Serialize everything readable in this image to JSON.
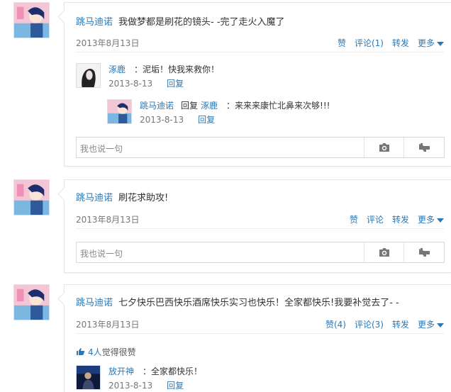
{
  "posts": [
    {
      "user": "跳马迪诺",
      "text": "我做梦都是刷花的镜头- -完了走火入魔了",
      "date": "2013年8月13日",
      "actions": {
        "like": "赞",
        "comment": "评论(1)",
        "share": "转发",
        "more": "更多"
      },
      "comments": [
        {
          "user": "涿鹿",
          "text": "：泥垢！快我来救你！",
          "date": "2013-8-13",
          "reply_label": "回复"
        }
      ],
      "subreply": {
        "user": "跳马迪诺",
        "reply_word": "回复",
        "reply_to": "涿鹿",
        "text": "：来来来康忙北鼻来次够!!!",
        "date": "2013-8-13",
        "reply_label": "回复"
      },
      "input_placeholder": "我也说一句"
    },
    {
      "user": "跳马迪诺",
      "text": "刷花求助攻!",
      "date": "2013年8月13日",
      "actions": {
        "like": "赞",
        "comment": "评论",
        "share": "转发",
        "more": "更多"
      },
      "input_placeholder": "我也说一句"
    },
    {
      "user": "跳马迪诺",
      "text": "七夕快乐巴西快乐酒席快乐实习也快乐！全家都快乐!我要补觉去了- -",
      "date": "2013年8月13日",
      "actions": {
        "like": "赞(4)",
        "comment": "评论(3)",
        "share": "转发",
        "more": "更多"
      },
      "likes_count": "4人",
      "likes_text": "觉得很赞",
      "comments": [
        {
          "user": "放开神",
          "text": "：全家都快乐！",
          "date": "2013-8-13",
          "reply_label": "回复"
        }
      ]
    }
  ],
  "icons": {
    "camera": "camera-icon",
    "thumb": "thumb-icon",
    "like": "like-thumb-icon",
    "more_caret": "caret-down-icon"
  },
  "colors": {
    "link": "#2b78b5",
    "text": "#333333",
    "muted": "#777777",
    "border": "#e6e6e6"
  }
}
